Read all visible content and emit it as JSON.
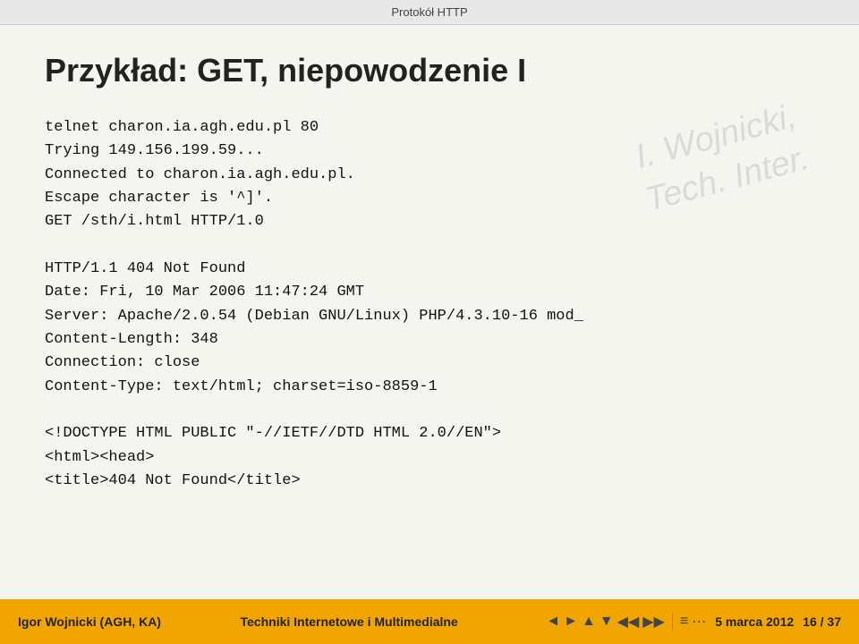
{
  "topbar": {
    "title": "Protokół HTTP"
  },
  "slide": {
    "title": "Przykład: GET, niepowodzenie I",
    "code_lines": [
      "telnet charon.ia.agh.edu.pl 80",
      "Trying 149.156.199.59...",
      "Connected to charon.ia.agh.edu.pl.",
      "Escape character is '^]'.",
      "GET /sth/i.html HTTP/1.0",
      "",
      "HTTP/1.1 404 Not Found",
      "Date: Fri, 10 Mar 2006 11:47:24 GMT",
      "Server: Apache/2.0.54 (Debian GNU/Linux) PHP/4.3.10-16 mod_",
      "Content-Length: 348",
      "Connection: close",
      "Content-Type: text/html; charset=iso-8859-1",
      "",
      "<!DOCTYPE HTML PUBLIC \"-//IETF//DTD HTML 2.0//EN\">",
      "<html><head>",
      "<title>404 Not Found</title>"
    ]
  },
  "watermark": {
    "line1": "I. Wojnicki,",
    "line2": "Tech. Inter."
  },
  "footer": {
    "left": "Igor Wojnicki (AGH, KA)",
    "center": "Techniki Internetowe i Multimedialne",
    "date": "5 marca 2012",
    "page": "16 / 37"
  }
}
